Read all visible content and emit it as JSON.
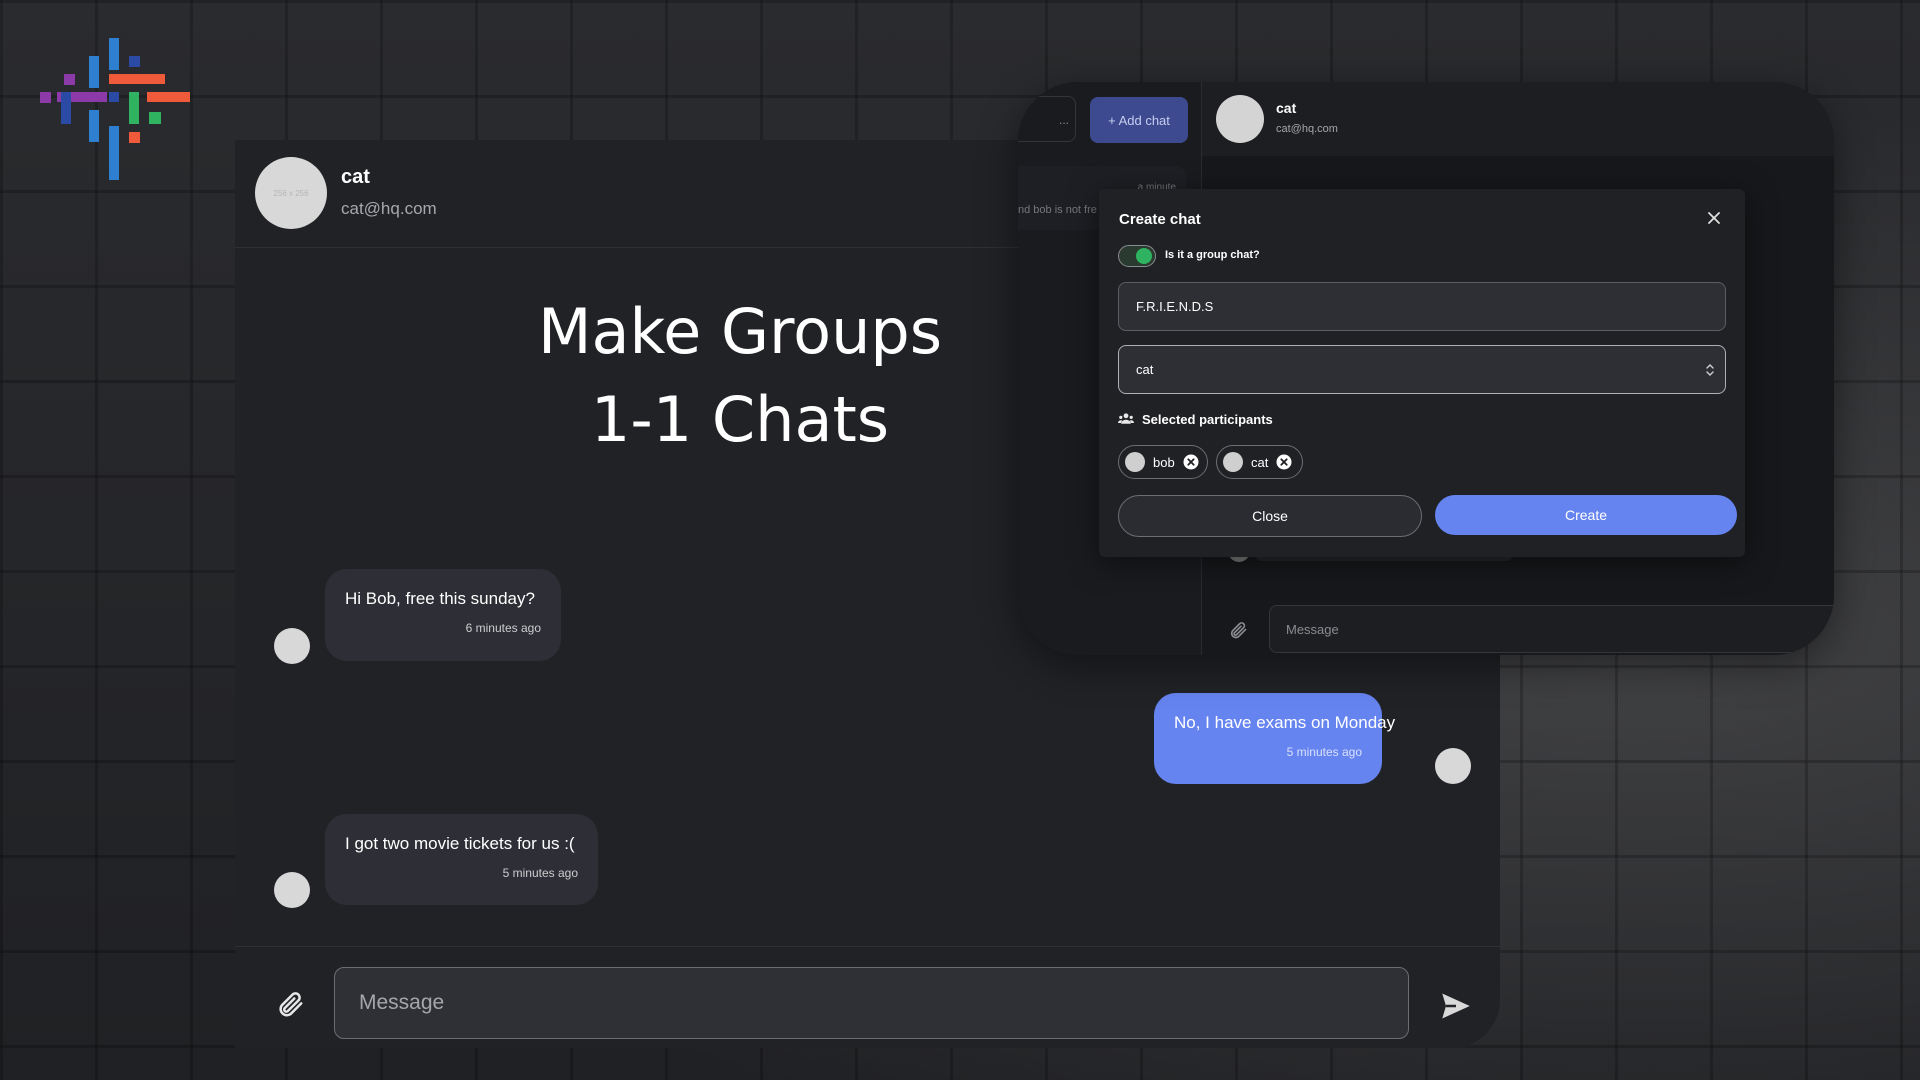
{
  "colors": {
    "accent": "#6684f0",
    "toggle_on": "#2fb360",
    "background": "#202124",
    "panel": "#212226"
  },
  "main": {
    "contact_name": "cat",
    "contact_email": "cat@hq.com",
    "avatar_placeholder": "256 x 256",
    "headline_line1": "Make Groups",
    "headline_line2": "1-1 Chats",
    "messages": [
      {
        "text": "Hi Bob, free this sunday?",
        "time": "6 minutes ago",
        "direction": "incoming"
      },
      {
        "text": "No, I have exams on Monday",
        "time": "5 minutes ago",
        "direction": "outgoing"
      },
      {
        "text": "I got two movie tickets for us :(",
        "time": "5 minutes ago",
        "direction": "incoming"
      }
    ],
    "composer_placeholder": "Message",
    "icons": {
      "attach": "paperclip-icon",
      "send": "send-icon"
    }
  },
  "secondary": {
    "search_text": "...",
    "add_chat_label": "+ Add chat",
    "chat_item_time": "a minute",
    "chat_item_preview": "nd bob is not fre",
    "contact_name": "cat",
    "contact_email": "cat@hq.com",
    "composer_placeholder": "Message"
  },
  "modal": {
    "title": "Create chat",
    "group_toggle_label": "Is it a group chat?",
    "group_toggle_on": true,
    "group_name_value": "F.R.I.E.N.D.S",
    "participant_select_value": "cat",
    "participants_heading": "Selected participants",
    "participants": [
      "bob",
      "cat"
    ],
    "close_label": "Close",
    "create_label": "Create"
  }
}
